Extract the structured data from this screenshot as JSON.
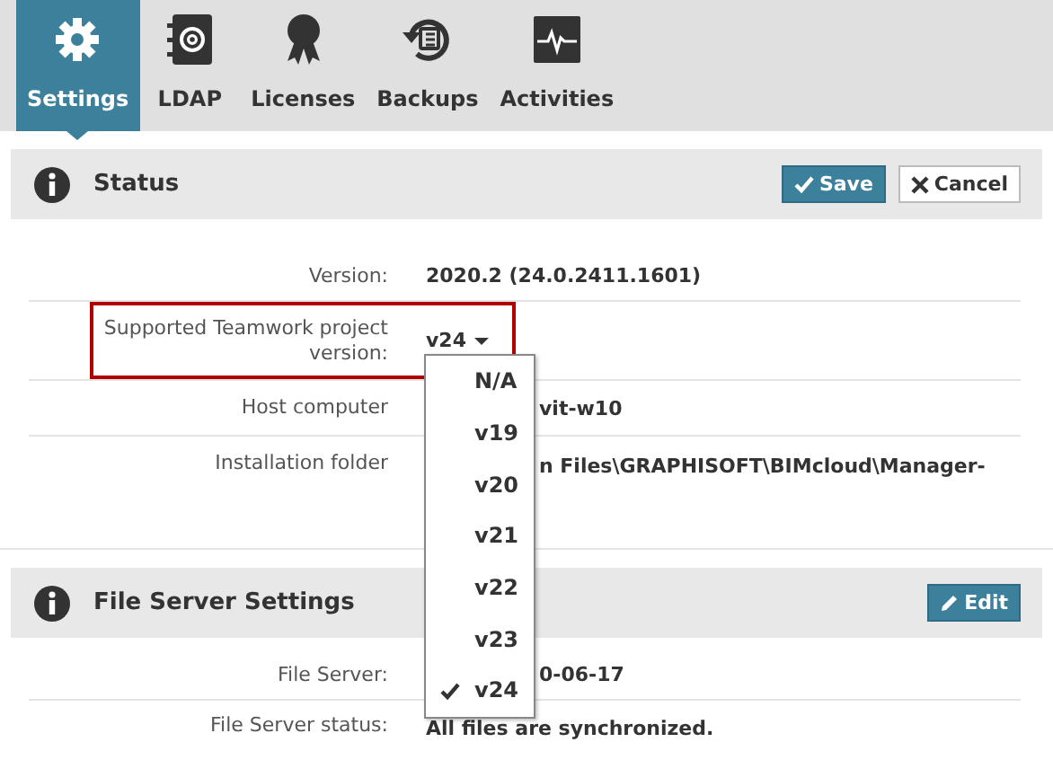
{
  "tabs": [
    {
      "label": "Settings",
      "selected": true
    },
    {
      "label": "LDAP",
      "selected": false
    },
    {
      "label": "Licenses",
      "selected": false
    },
    {
      "label": "Backups",
      "selected": false
    },
    {
      "label": "Activities",
      "selected": false
    }
  ],
  "panels": [
    {
      "title": "Status",
      "buttons": [
        {
          "kind": "save",
          "label": "Save"
        },
        {
          "kind": "cancel",
          "label": "Cancel"
        }
      ],
      "rows": [
        {
          "label": "Version:",
          "value": "2020.2 (24.0.2411.1601)",
          "kind": "text"
        },
        {
          "label": "Supported Teamwork project version:",
          "value": "v24",
          "kind": "select",
          "highlighted": true
        },
        {
          "label": "Host computer",
          "value": "vit-w10",
          "kind": "text",
          "covered": true
        },
        {
          "label": "Installation folder",
          "value": "n Files\\GRAPHISOFT\\BIMcloud\\Manager-",
          "kind": "text",
          "covered": true
        }
      ]
    },
    {
      "title": "File Server Settings",
      "buttons": [
        {
          "kind": "edit",
          "label": "Edit"
        }
      ],
      "rows": [
        {
          "label": "File Server:",
          "value": "0-06-17",
          "kind": "text",
          "covered": true
        },
        {
          "label": "File Server status:",
          "value": "All files are synchronized.",
          "kind": "text"
        }
      ]
    }
  ],
  "dropdown": {
    "options": [
      {
        "label": "N/A",
        "selected": false
      },
      {
        "label": "v19",
        "selected": false
      },
      {
        "label": "v20",
        "selected": false
      },
      {
        "label": "v21",
        "selected": false
      },
      {
        "label": "v22",
        "selected": false
      },
      {
        "label": "v23",
        "selected": false
      },
      {
        "label": "v24",
        "selected": true
      }
    ]
  }
}
